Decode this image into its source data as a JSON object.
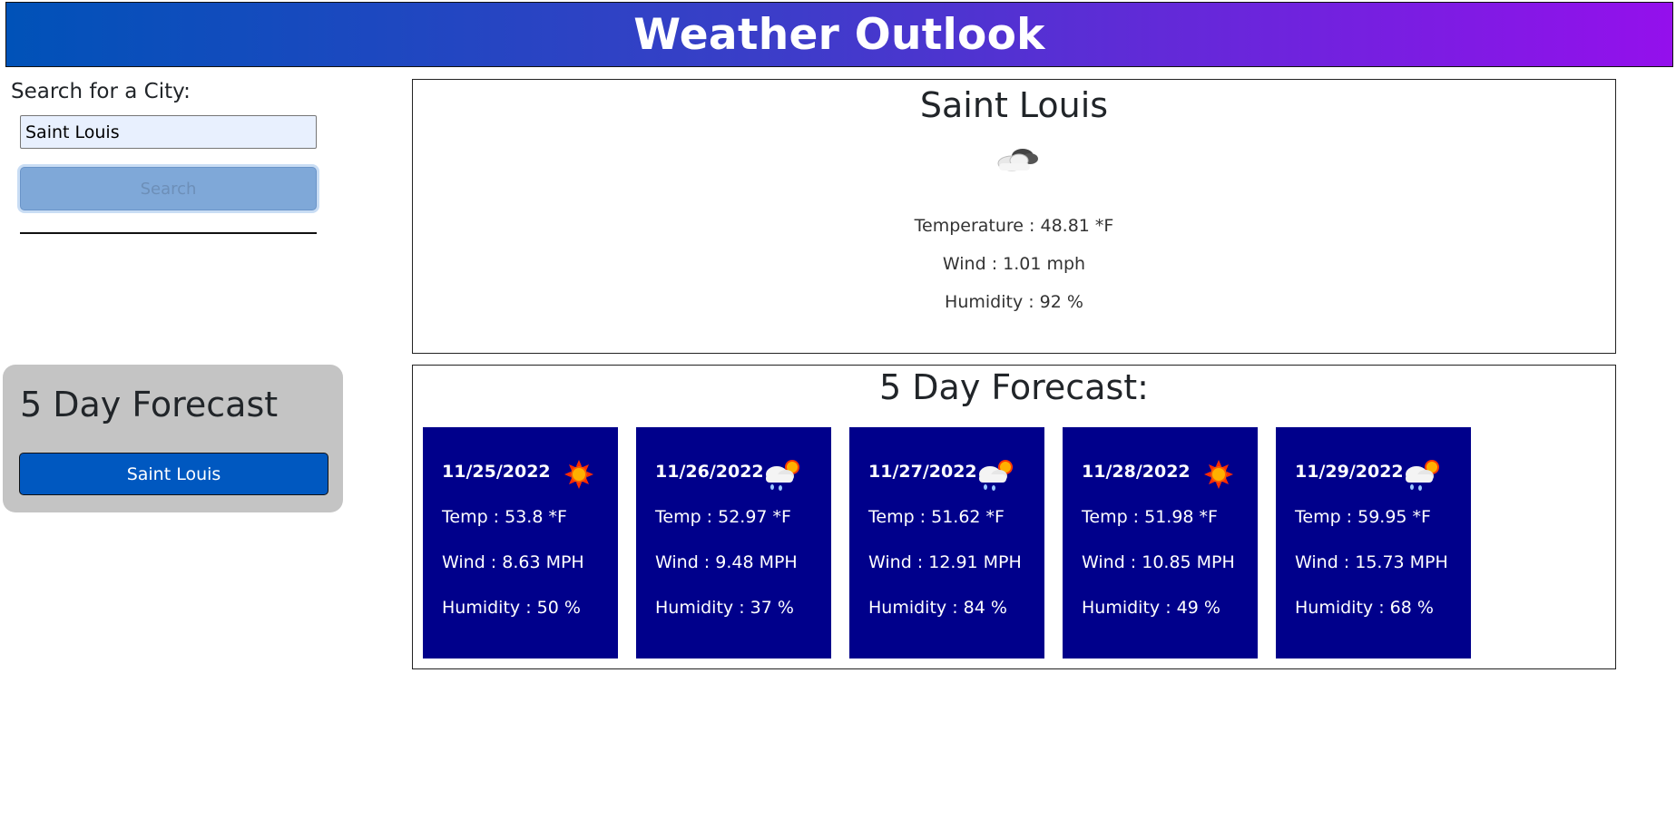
{
  "header": {
    "title": "Weather Outlook"
  },
  "search": {
    "label": "Search for a City:",
    "value": "Saint Louis",
    "button_label": "Search"
  },
  "history": {
    "title": "5 Day Forecast",
    "items": [
      "Saint Louis"
    ]
  },
  "current": {
    "city": "Saint Louis",
    "icon": "cloudy-icon",
    "temperature": "Temperature : 48.81 *F",
    "wind": "Wind : 1.01 mph",
    "humidity": "Humidity : 92 %"
  },
  "forecast": {
    "title": "5 Day Forecast:",
    "days": [
      {
        "date": "11/25/2022",
        "icon": "sun-icon",
        "temp": "Temp : 53.8 *F",
        "wind": "Wind : 8.63 MPH",
        "humidity": "Humidity : 50 %"
      },
      {
        "date": "11/26/2022",
        "icon": "rain-sun-cloud-icon",
        "temp": "Temp : 52.97 *F",
        "wind": "Wind : 9.48 MPH",
        "humidity": "Humidity : 37 %"
      },
      {
        "date": "11/27/2022",
        "icon": "rain-sun-cloud-icon",
        "temp": "Temp : 51.62 *F",
        "wind": "Wind : 12.91 MPH",
        "humidity": "Humidity : 84 %"
      },
      {
        "date": "11/28/2022",
        "icon": "sun-icon",
        "temp": "Temp : 51.98 *F",
        "wind": "Wind : 10.85 MPH",
        "humidity": "Humidity : 49 %"
      },
      {
        "date": "11/29/2022",
        "icon": "rain-sun-cloud-icon",
        "temp": "Temp : 59.95 *F",
        "wind": "Wind : 15.73 MPH",
        "humidity": "Humidity : 68 %"
      }
    ]
  },
  "colors": {
    "header_start": "#0052b8",
    "header_end": "#9410ec",
    "card_background": "#00008b",
    "history_button": "#0058c0",
    "history_panel": "#c4c4c4"
  }
}
